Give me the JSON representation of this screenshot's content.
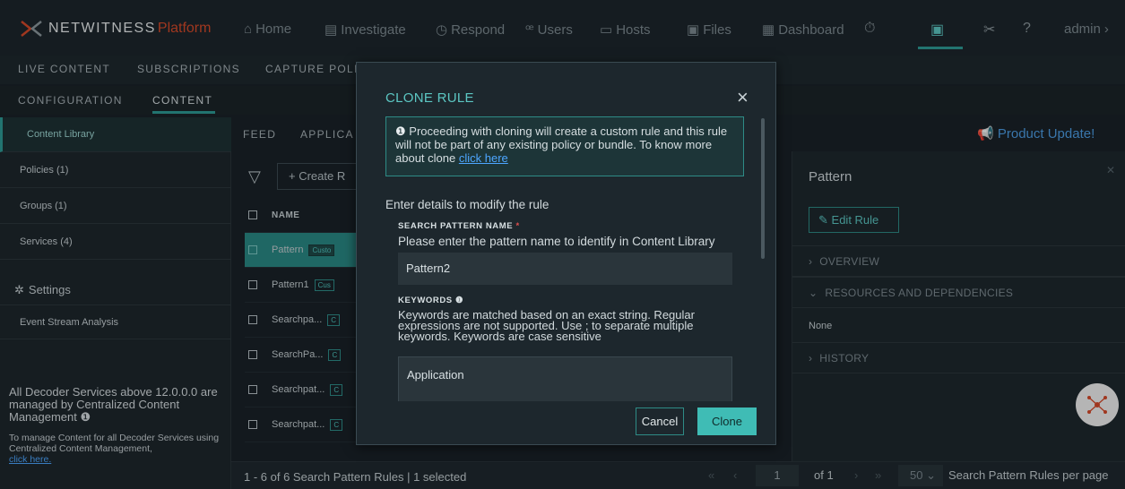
{
  "app": {
    "brand": "NETWITNESS",
    "brand_suffix": "Platform",
    "user": "admin"
  },
  "nav": [
    {
      "label": "Home",
      "icon": "home-icon"
    },
    {
      "label": "Investigate",
      "icon": "investigate-icon"
    },
    {
      "label": "Respond",
      "icon": "respond-icon"
    },
    {
      "label": "Users",
      "icon": "users-icon"
    },
    {
      "label": "Hosts",
      "icon": "hosts-icon"
    },
    {
      "label": "Files",
      "icon": "files-icon"
    },
    {
      "label": "Dashboard",
      "icon": "dashboard-icon"
    }
  ],
  "subnav1": [
    "LIVE CONTENT",
    "SUBSCRIPTIONS",
    "CAPTURE POLI"
  ],
  "subnav2": [
    "CONFIGURATION",
    "CONTENT"
  ],
  "sidebar": {
    "items": [
      "Content Library",
      "Policies (1)",
      "Groups (1)",
      "Services (4)"
    ],
    "settings": "Settings",
    "settings_item": "Event Stream Analysis",
    "note_title": "All Decoder Services above 12.0.0.0 are managed by Centralized Content Management",
    "note_body": "To manage Content for all Decoder Services using Centralized Content Management,",
    "note_link": "click here."
  },
  "main": {
    "tabs": [
      "FEED",
      "APPLICA"
    ],
    "create_label": "Create R",
    "col_name": "NAME",
    "rows": [
      {
        "name": "Pattern",
        "tag": "Custo"
      },
      {
        "name": "Pattern1",
        "tag": "Cus"
      },
      {
        "name": "Searchpa...",
        "tag": "C"
      },
      {
        "name": "SearchPa...",
        "tag": "C"
      },
      {
        "name": "Searchpat...",
        "tag": "C"
      },
      {
        "name": "Searchpat...",
        "tag": "C"
      }
    ],
    "product_update": "Product Update!"
  },
  "right_panel": {
    "title": "Pattern",
    "edit_rule": "Edit Rule",
    "overview": "OVERVIEW",
    "resources": "RESOURCES AND DEPENDENCIES",
    "resources_value": "None",
    "history": "HISTORY"
  },
  "bottom": {
    "summary": "1 - 6 of 6 Search Pattern Rules | 1 selected",
    "page": "1",
    "of_label": "of 1",
    "per_page": "50",
    "per_page_label": "Search Pattern Rules per page"
  },
  "modal": {
    "title": "CLONE RULE",
    "info_text": "Proceeding with cloning will create a custom rule and this rule will not be part of any existing policy or bundle. To know more about clone",
    "info_link": "click here",
    "intro": "Enter details to modify the rule",
    "name_label": "SEARCH PATTERN NAME",
    "name_help": "Please enter the pattern name to identify in Content Library",
    "name_value": "Pattern2",
    "keywords_label": "KEYWORDS",
    "keywords_help": "Keywords are matched based on an exact string. Regular expressions are not supported. Use ; to separate multiple keywords. Keywords are case sensitive",
    "keywords_value": "Application",
    "cancel": "Cancel",
    "clone": "Clone"
  }
}
